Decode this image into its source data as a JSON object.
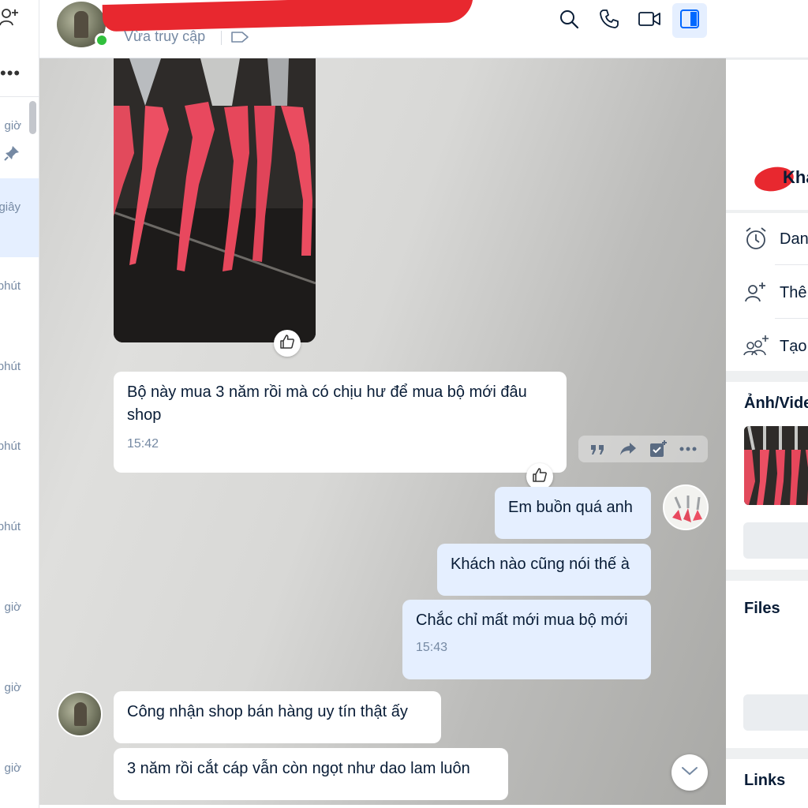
{
  "left_list": {
    "rows": [
      {
        "time": "giờ"
      },
      {
        "time": "giây"
      },
      {
        "time": "phút"
      },
      {
        "time": "phút"
      },
      {
        "time": "phút"
      },
      {
        "time": "phút"
      },
      {
        "time": "giờ"
      },
      {
        "time": "giờ"
      },
      {
        "time": "giờ"
      }
    ]
  },
  "header": {
    "status": "Vừa truy cập"
  },
  "messages": [
    {
      "text": "Bộ này mua 3 năm rồi mà có chịu hư để mua bộ mới đâu shop",
      "time": "15:42"
    },
    {
      "text": "Em buồn quá anh"
    },
    {
      "text": "Khách nào cũng nói thế à"
    },
    {
      "text": "Chắc chỉ mất mới mua bộ mới",
      "time": "15:43"
    },
    {
      "text": "Công nhận shop bán hàng uy tín thật ấy"
    },
    {
      "text": "3 năm rồi cắt cáp vẫn còn ngọt như dao lam luôn"
    }
  ],
  "right_panel": {
    "name": "Kha",
    "actions": [
      {
        "label": "Dan",
        "icon": "alarm-clock-icon"
      },
      {
        "label": "Thê",
        "icon": "add-member-icon"
      },
      {
        "label": "Tạo",
        "icon": "create-group-icon"
      }
    ],
    "media_title": "Ảnh/Vide",
    "files_title": "Files",
    "links_title": "Links"
  },
  "colors": {
    "accent": "#0068ff",
    "incoming_bubble": "#ffffff",
    "outgoing_bubble": "#e5efff",
    "online": "#30c03c",
    "muted_text": "#7589a3"
  }
}
